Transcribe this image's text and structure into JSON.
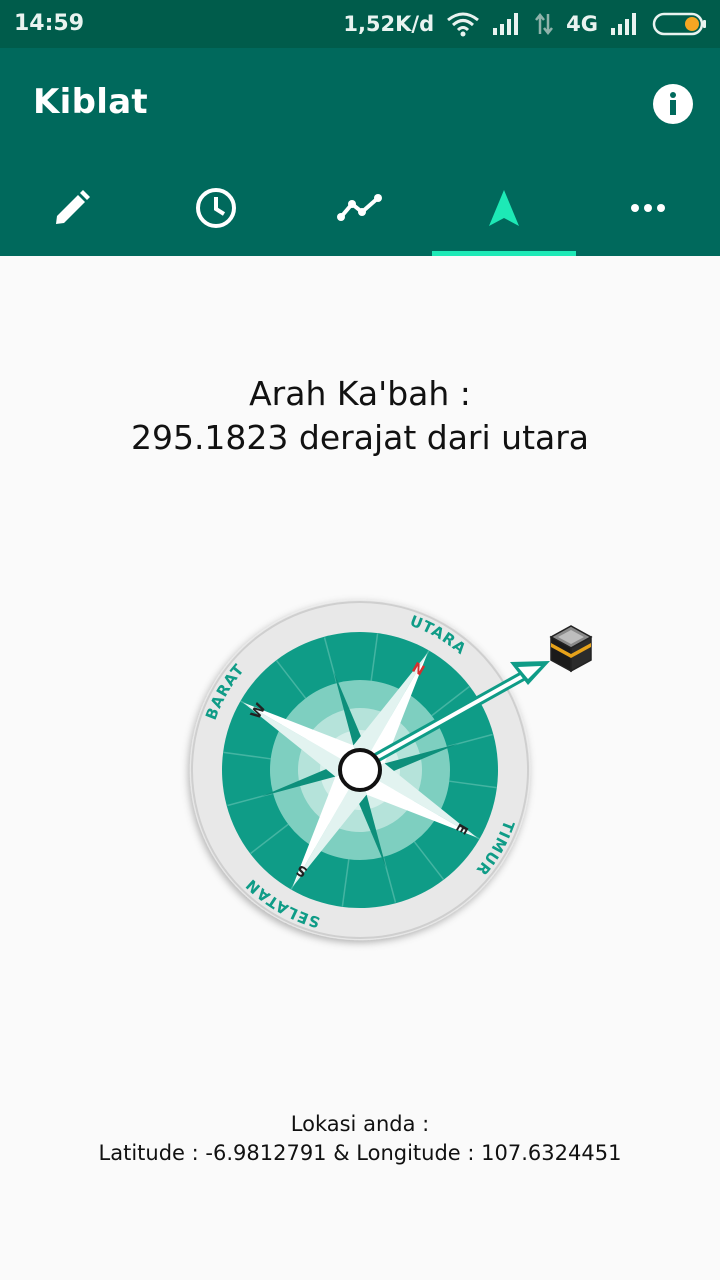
{
  "status_bar": {
    "time": "14:59",
    "speed": "1,52K/d",
    "network": "4G",
    "icons": [
      "wifi-icon",
      "signal-icon",
      "data-transfer-icon",
      "signal-icon",
      "battery-icon"
    ]
  },
  "app_bar": {
    "title": "Kiblat",
    "info_icon": "info-icon"
  },
  "tabs": [
    {
      "icon": "pencil-icon",
      "selected": false
    },
    {
      "icon": "clock-icon",
      "selected": false
    },
    {
      "icon": "trend-line-icon",
      "selected": false
    },
    {
      "icon": "navigation-arrow-icon",
      "selected": true
    },
    {
      "icon": "more-horizontal-icon",
      "selected": false
    }
  ],
  "qibla": {
    "line1": "Arah Ka'bah :",
    "line2": "295.1823 derajat dari utara"
  },
  "compass": {
    "labels": {
      "north": "UTARA",
      "south": "SELATAN",
      "east": "TIMUR",
      "west": "BARAT"
    },
    "letters": {
      "north": "N",
      "south": "S",
      "east": "E",
      "west": "W"
    },
    "kaaba_icon": "kaaba-icon"
  },
  "location": {
    "label": "Lokasi anda :",
    "coords": "Latitude : -6.9812791 & Longitude : 107.6324451"
  },
  "colors": {
    "status_bar": "#005c4b",
    "app_bar": "#00695c",
    "tab_indicator": "#1de9b6",
    "compass_teal": "#0f9c87",
    "background": "#fafafa"
  }
}
